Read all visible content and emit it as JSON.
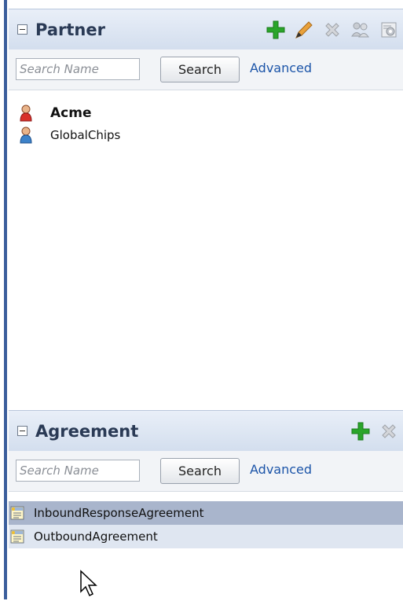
{
  "partner": {
    "title": "Partner",
    "search_placeholder": "Search Name",
    "search_label": "Search",
    "advanced_label": "Advanced",
    "tools": [
      "add-icon",
      "edit-icon",
      "delete-icon",
      "users-icon",
      "settings-icon"
    ],
    "items": [
      {
        "label": "Acme",
        "icon": "user-red-icon"
      },
      {
        "label": "GlobalChips",
        "icon": "user-blue-icon"
      }
    ]
  },
  "agreement": {
    "title": "Agreement",
    "search_placeholder": "Search Name",
    "search_label": "Search",
    "advanced_label": "Advanced",
    "tools": [
      "add-icon",
      "delete-icon"
    ],
    "items": [
      {
        "label": "InboundResponseAgreement",
        "icon": "agreement-icon",
        "selected": true
      },
      {
        "label": "OutboundAgreement",
        "icon": "agreement-icon"
      }
    ]
  },
  "colors": {
    "header": "#d9e2f0",
    "selected_row": "#a9b5cc",
    "hover_row": "#dfe6f1",
    "link": "#1b54a8",
    "add_green": "#2aa52a"
  }
}
